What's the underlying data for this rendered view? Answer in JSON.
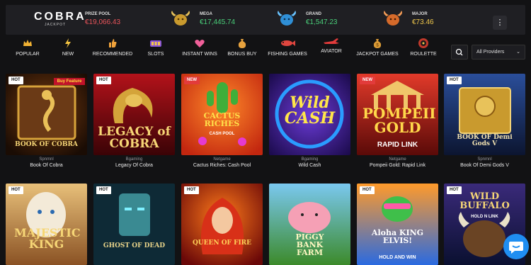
{
  "brand": {
    "title": "COBRA",
    "subtitle": "JACKPOT"
  },
  "jackpots": [
    {
      "label": "PRIZE POOL",
      "value": "€19,066.43",
      "color": "#e9545a"
    },
    {
      "label": "MEGA",
      "value": "€17,445.74",
      "color": "#4ad07a",
      "icon": "gold-bull-icon"
    },
    {
      "label": "GRAND",
      "value": "€1,547.23",
      "color": "#4ad07a",
      "icon": "blue-bull-icon"
    },
    {
      "label": "MAJOR",
      "value": "€73.46",
      "color": "#f2c94c",
      "icon": "orange-bull-icon"
    }
  ],
  "more_label": "⋮",
  "nav": [
    {
      "label": "POPULAR",
      "icon": "crown-icon"
    },
    {
      "label": "NEW",
      "icon": "lightning-icon"
    },
    {
      "label": "RECOMMENDED",
      "icon": "thumbs-up-icon"
    },
    {
      "label": "SLOTS",
      "icon": "slot-reels-icon"
    },
    {
      "label": "INSTANT WINS",
      "icon": "heart-icon"
    },
    {
      "label": "BONUS BUY",
      "icon": "money-bag-icon"
    },
    {
      "label": "FISHING GAMES",
      "icon": "fish-icon"
    },
    {
      "label": "AVIATOR",
      "icon": "plane-icon"
    },
    {
      "label": "JACKPOT GAMES",
      "icon": "gold-bag-icon"
    },
    {
      "label": "ROULETTE",
      "icon": "roulette-icon"
    }
  ],
  "provider_filter": {
    "value": "All Providers"
  },
  "games": [
    {
      "badge": "HOT",
      "provider": "Spnmnl",
      "name": "Book Of Cobra",
      "art_title": "BOOK OF COBRA",
      "art_extra": "Buy Feature"
    },
    {
      "badge": "HOT",
      "provider": "Bgaming",
      "name": "Legacy Of Cobra",
      "art_title": "LEGACY of COBRA"
    },
    {
      "badge": "NEW",
      "provider": "Netgame",
      "name": "Cactus Riches: Cash Pool",
      "art_title": "CACTUS RICHES",
      "art_extra": "CASH POOL"
    },
    {
      "badge": "",
      "provider": "Bgaming",
      "name": "Wild Cash",
      "art_title": "Wild CASH"
    },
    {
      "badge": "NEW",
      "provider": "Netgame",
      "name": "Pompeii Gold: Rapid Link",
      "art_title": "POMPEII GOLD",
      "art_extra": "RAPID LINK"
    },
    {
      "badge": "HOT",
      "provider": "Spnmnl",
      "name": "Book Of Demi Gods V",
      "art_title": "BOOK OF Demi Gods V"
    },
    {
      "badge": "HOT",
      "art_title": "MAJESTIC KING"
    },
    {
      "badge": "HOT",
      "art_title": "GHOST OF DEAD"
    },
    {
      "badge": "HOT",
      "art_title": "QUEEN OF FIRE"
    },
    {
      "badge": "",
      "art_title": "PIGGY BANK FARM"
    },
    {
      "badge": "HOT",
      "art_title": "Aloha KING ELVIS!",
      "art_extra": "HOLD AND WIN"
    },
    {
      "badge": "HOT",
      "art_title": "WILD BUFFALO",
      "art_extra": "HOLD N LINK"
    }
  ],
  "colors": {
    "background": "#121214",
    "panel": "#1f1f23",
    "accent": "#1f8ef1",
    "hot_badge": "#ffffff",
    "new_badge": "#e23b3b"
  }
}
